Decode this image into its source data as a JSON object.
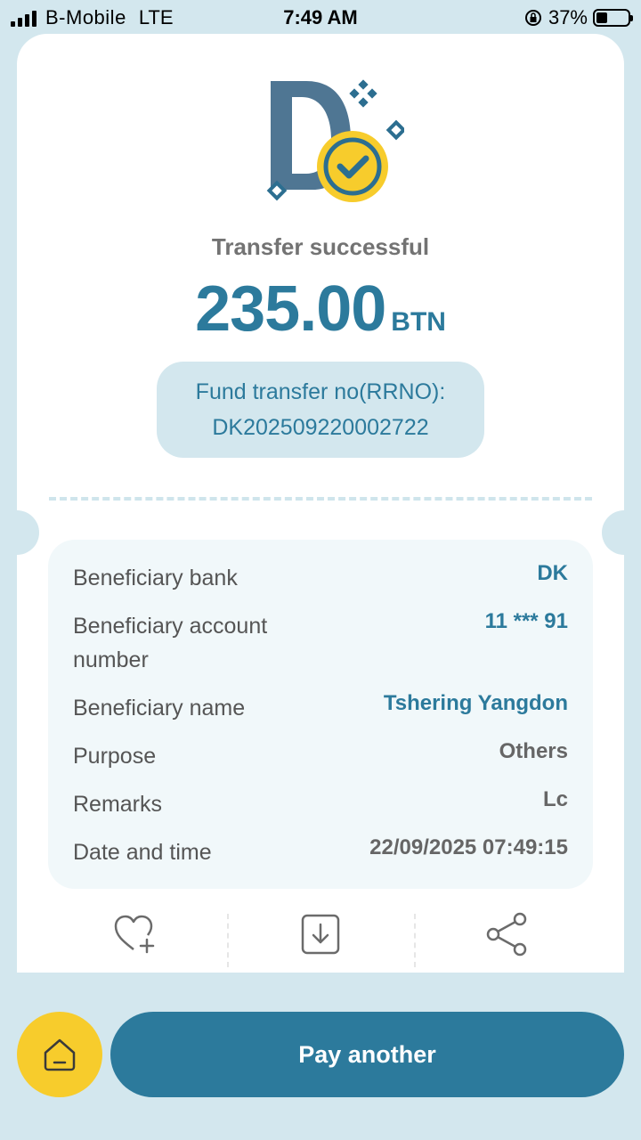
{
  "status_bar": {
    "carrier": "B-Mobile",
    "network": "LTE",
    "time": "7:49 AM",
    "battery": "37%"
  },
  "receipt": {
    "title": "Transfer successful",
    "amount": "235.00",
    "currency": "BTN",
    "rrn_label": "Fund transfer no(RRNO):",
    "rrn_value": "DK202509220002722"
  },
  "details": [
    {
      "label": "Beneficiary bank",
      "value": "DK"
    },
    {
      "label": "Beneficiary account number",
      "value": "11 *** 91"
    },
    {
      "label": "Beneficiary name",
      "value": "Tshering Yangdon"
    },
    {
      "label": "Purpose",
      "value": "Others"
    },
    {
      "label": "Remarks",
      "value": "Lc"
    },
    {
      "label": "Date and time",
      "value": "22/09/2025 07:49:15"
    }
  ],
  "actions": {
    "favorite_icon": "heart-plus-icon",
    "download_icon": "download-icon",
    "share_icon": "share-icon"
  },
  "bottom": {
    "home_icon": "home-icon",
    "pay_another_label": "Pay another"
  },
  "colors": {
    "primary": "#2c7a9c",
    "accent": "#f7cc2c",
    "background": "#d3e7ee"
  }
}
